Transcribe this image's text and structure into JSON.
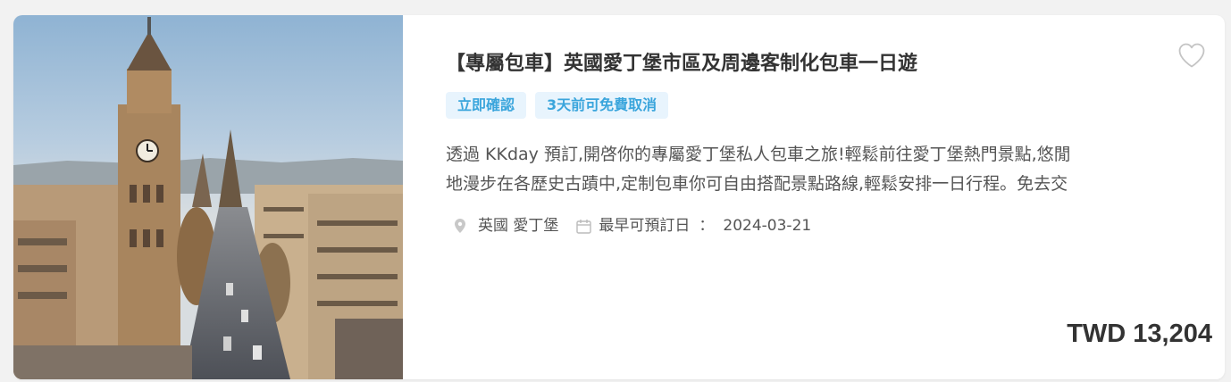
{
  "product": {
    "title": "【專屬包車】英國愛丁堡市區及周邊客制化包車一日遊",
    "tags": [
      "立即確認",
      "3天前可免費取消"
    ],
    "description_lines": [
      "透過 KKday 預訂,開啓你的專屬愛丁堡私人包車之旅!輕鬆前往愛丁堡熱門景點,悠閒",
      "地漫步在各歷史古蹟中,定制包車你可自由搭配景點路線,輕鬆安排一日行程。免去交"
    ],
    "location": "英國 愛丁堡",
    "earliest_label": "最早可預訂日",
    "earliest_sep": "：",
    "earliest_date": "2024-03-21",
    "price": "TWD 13,204",
    "icons": {
      "favorite": "heart-outline-icon",
      "location": "map-pin-icon",
      "calendar": "calendar-icon"
    },
    "colors": {
      "tag_bg": "#e8f4fd",
      "tag_text": "#3aa5dc",
      "title": "#333333"
    }
  }
}
